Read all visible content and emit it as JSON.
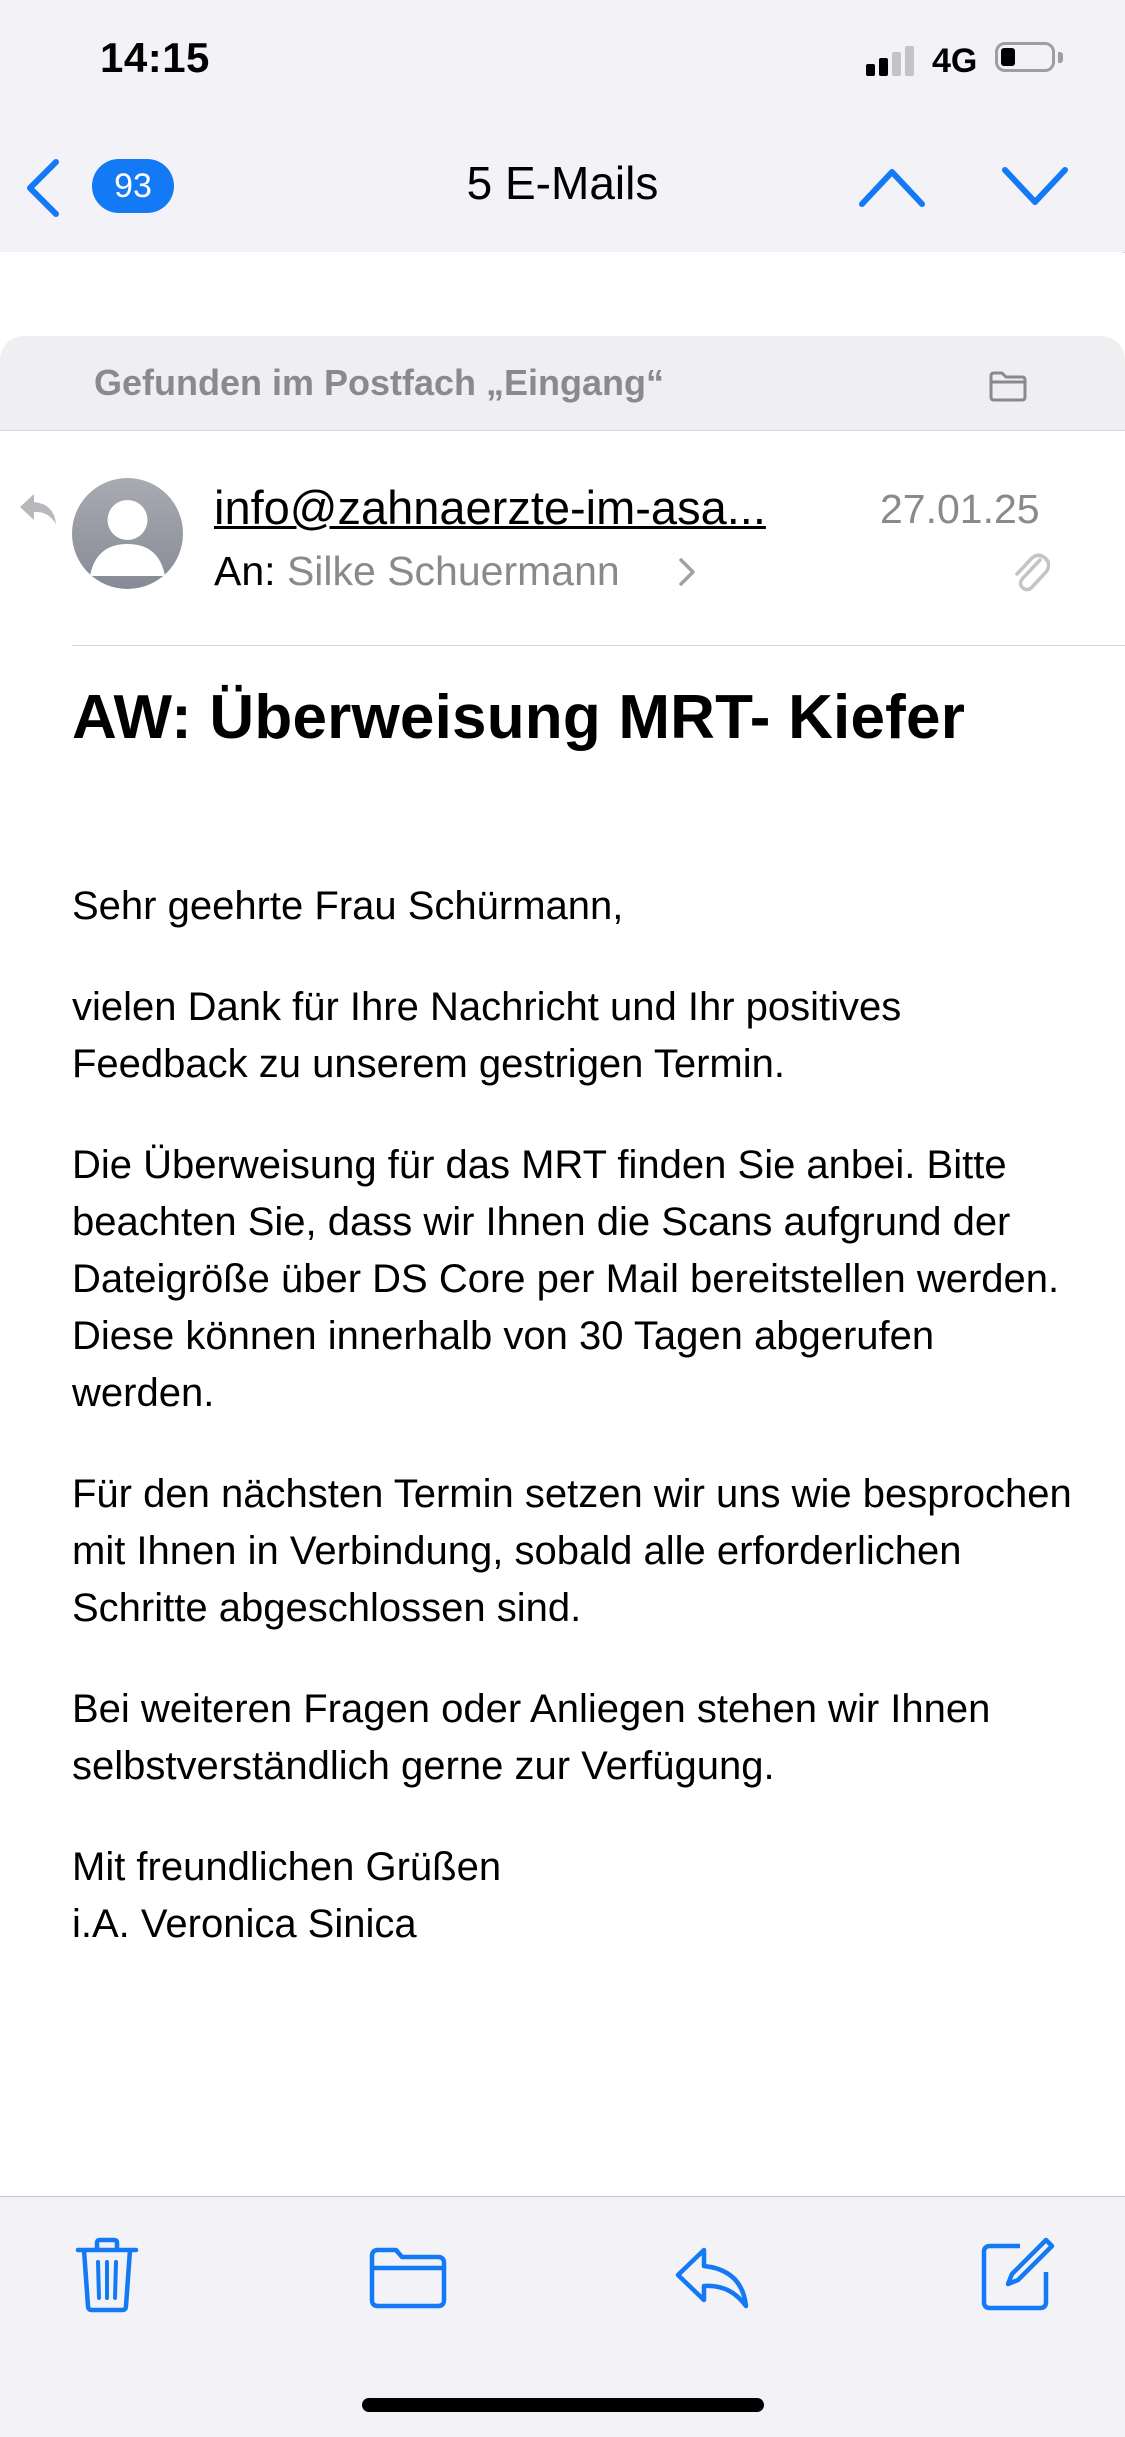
{
  "status_bar": {
    "time": "14:15",
    "network": "4G"
  },
  "nav": {
    "unread_count": "93",
    "title": "5 E-Mails"
  },
  "mailbox_banner": {
    "text": "Gefunden im Postfach „Eingang“",
    "icon": "folder-icon"
  },
  "message": {
    "sender": "info@zahnaerzte-im-asa...",
    "date": "27.01.25",
    "to_label": "An:",
    "to_name": "Silke Schuermann",
    "subject": "AW: Überweisung MRT- Kiefer",
    "body": [
      "Sehr geehrte Frau Schürmann,",
      "vielen Dank für Ihre Nachricht und Ihr positives Feedback zu unserem gestrigen Termin.",
      "Die Überweisung für das MRT finden Sie anbei. Bitte beachten Sie, dass wir Ihnen die Scans aufgrund der Dateigröße über DS Core per Mail bereitstellen werden. Diese können innerhalb von 30 Tagen abgerufen werden.",
      "Für den nächsten Termin setzen wir uns wie besprochen mit Ihnen in Verbindung, sobald alle erforderlichen Schritte abgeschlossen sind.",
      "Bei weiteren Fragen oder Anliegen stehen wir Ihnen selbstverständlich gerne zur Verfügung."
    ],
    "closing": "Mit freundlichen Grüßen",
    "signature": "i.A. Veronica Sinica"
  },
  "toolbar": {
    "icons": [
      "trash-icon",
      "folder-icon",
      "reply-icon",
      "compose-icon"
    ]
  },
  "colors": {
    "accent": "#1479f5",
    "secondary_text": "#8a8a8e",
    "chrome_background": "#f2f2f7"
  }
}
